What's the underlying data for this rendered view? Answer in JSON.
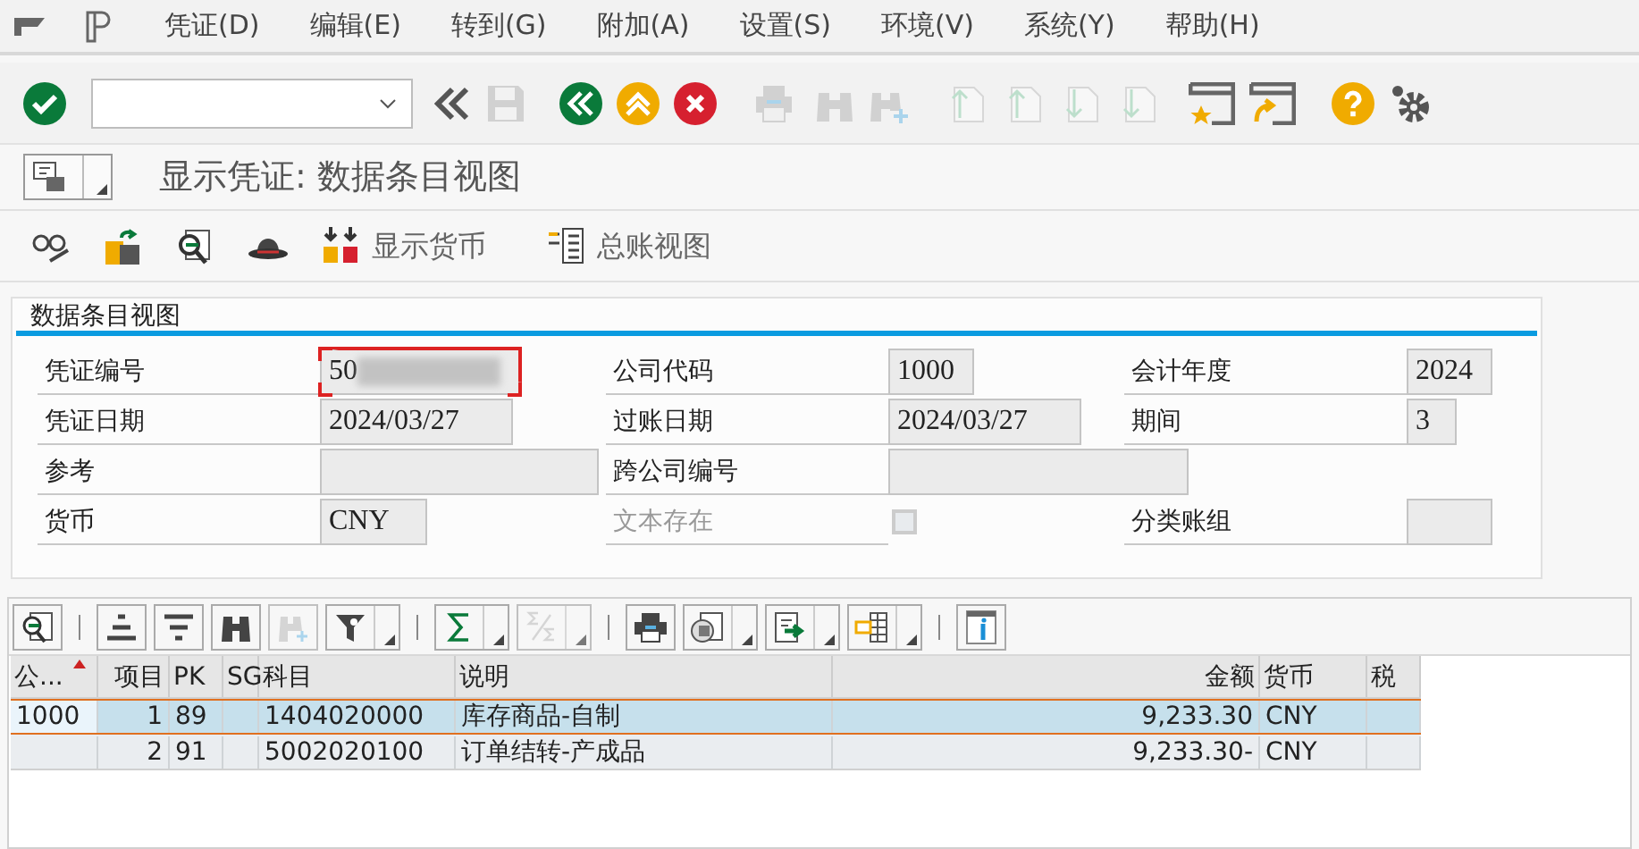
{
  "menu": [
    {
      "label": "凭证(D)"
    },
    {
      "label": "编辑(E)"
    },
    {
      "label": "转到(G)"
    },
    {
      "label": "附加(A)"
    },
    {
      "label": "设置(S)"
    },
    {
      "label": "环境(V)"
    },
    {
      "label": "系统(Y)"
    },
    {
      "label": "帮助(H)"
    }
  ],
  "toolbar": [
    {
      "kind": "enter",
      "disabled": false
    },
    {
      "kind": "command"
    },
    {
      "kind": "collapse",
      "disabled": false
    },
    {
      "kind": "save",
      "disabled": true
    },
    {
      "kind": "back",
      "disabled": false
    },
    {
      "kind": "exit",
      "disabled": false
    },
    {
      "kind": "cancel",
      "disabled": false
    },
    {
      "kind": "print",
      "disabled": true
    },
    {
      "kind": "find",
      "disabled": true
    },
    {
      "kind": "find-next",
      "disabled": true
    },
    {
      "kind": "first-page",
      "disabled": true
    },
    {
      "kind": "prev-page",
      "disabled": true
    },
    {
      "kind": "next-page",
      "disabled": true
    },
    {
      "kind": "last-page",
      "disabled": true
    },
    {
      "kind": "new-session",
      "disabled": false
    },
    {
      "kind": "shortcut",
      "disabled": false
    },
    {
      "kind": "help",
      "disabled": false
    },
    {
      "kind": "options",
      "disabled": false
    }
  ],
  "title": "显示凭证: 数据条目视图",
  "app_toolbar": [
    {
      "kind": "glasses"
    },
    {
      "kind": "switch"
    },
    {
      "kind": "zoom"
    },
    {
      "kind": "hat"
    },
    {
      "kind": "currency",
      "label": "显示货币"
    },
    {
      "kind": "ledger",
      "label": "总账视图"
    }
  ],
  "group": {
    "title": "数据条目视图",
    "rows": [
      [
        {
          "label": "凭证编号",
          "value": "50",
          "kind": "field",
          "redacted": true
        },
        {
          "label": "公司代码",
          "value": "1000",
          "kind": "field"
        },
        {
          "label": "会计年度",
          "value": "2024",
          "kind": "field"
        }
      ],
      [
        {
          "label": "凭证日期",
          "value": "2024/03/27",
          "kind": "field"
        },
        {
          "label": "过账日期",
          "value": "2024/03/27",
          "kind": "field"
        },
        {
          "label": "期间",
          "value": "3",
          "kind": "field"
        }
      ],
      [
        {
          "label": "参考",
          "kind": "field"
        },
        {
          "label": "跨公司编号",
          "kind": "field"
        }
      ],
      [
        {
          "label": "货币",
          "value": "CNY",
          "kind": "field"
        },
        {
          "label": "文本存在",
          "kind": "checkbox",
          "checked": false,
          "disabled": true
        },
        {
          "label": "分类账组",
          "kind": "field"
        }
      ]
    ]
  },
  "alv_toolbar": [
    {
      "kind": "details",
      "menu": false,
      "disabled": false
    },
    {
      "kind": "sep"
    },
    {
      "kind": "sort-asc",
      "menu": false,
      "disabled": false
    },
    {
      "kind": "sort-desc",
      "menu": false,
      "disabled": false
    },
    {
      "kind": "find",
      "menu": false,
      "disabled": false
    },
    {
      "kind": "find-next",
      "menu": false,
      "disabled": true
    },
    {
      "kind": "filter",
      "menu": true,
      "disabled": false
    },
    {
      "kind": "sep"
    },
    {
      "kind": "sum",
      "menu": true,
      "disabled": false
    },
    {
      "kind": "subtotal",
      "menu": true,
      "disabled": true
    },
    {
      "kind": "sep"
    },
    {
      "kind": "print",
      "menu": false,
      "disabled": false
    },
    {
      "kind": "views",
      "menu": true,
      "disabled": false
    },
    {
      "kind": "export",
      "menu": true,
      "disabled": false
    },
    {
      "kind": "layout",
      "menu": true,
      "disabled": false
    },
    {
      "kind": "sep"
    },
    {
      "kind": "info",
      "menu": false,
      "disabled": false
    }
  ],
  "table": {
    "columns": [
      {
        "label": "公...",
        "sorted": true
      },
      {
        "label": "项目",
        "sorted": false
      },
      {
        "label": "PK",
        "sorted": false
      },
      {
        "label": "SG",
        "sorted": false
      },
      {
        "label": "科目",
        "sorted": false
      },
      {
        "label": "说明",
        "sorted": false
      },
      {
        "label": "金额",
        "sorted": false
      },
      {
        "label": "货币",
        "sorted": false
      },
      {
        "label": "税",
        "sorted": false
      }
    ],
    "rows": [
      {
        "selected": true,
        "cells": [
          "1000",
          "1",
          "89",
          "",
          "1404020000",
          "库存商品-自制",
          "9,233.30",
          "CNY",
          ""
        ]
      },
      {
        "selected": false,
        "cells": [
          "",
          "2",
          "91",
          "",
          "5002020100",
          "订单结转-产成品",
          "9,233.30-",
          "CNY",
          ""
        ]
      }
    ]
  }
}
